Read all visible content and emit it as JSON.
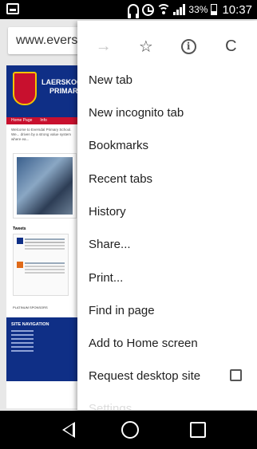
{
  "status_bar": {
    "battery_percent": "33%",
    "time": "10:37"
  },
  "browser": {
    "url": "www.evers"
  },
  "webpage": {
    "school_name_line1": "LAERSKOO",
    "school_name_line2": "PRIMARY",
    "nav_links": [
      "Home Page",
      "Info"
    ],
    "welcome_text": "Welcome to Eversdal Primary School. We... driven by a strong value system where ea...",
    "tweets_title": "Tweets",
    "sponsors_label": "PLATINUM SPONSORS",
    "site_navigation_label": "SITE NAVIGATION"
  },
  "menu": {
    "toolbar": {
      "forward": "→",
      "bookmark": "☆",
      "info": "i",
      "reload": "C"
    },
    "items": [
      {
        "label": "New tab"
      },
      {
        "label": "New incognito tab"
      },
      {
        "label": "Bookmarks"
      },
      {
        "label": "Recent tabs"
      },
      {
        "label": "History"
      },
      {
        "label": "Share..."
      },
      {
        "label": "Print..."
      },
      {
        "label": "Find in page"
      },
      {
        "label": "Add to Home screen"
      },
      {
        "label": "Request desktop site"
      },
      {
        "label": "Settings"
      }
    ]
  }
}
